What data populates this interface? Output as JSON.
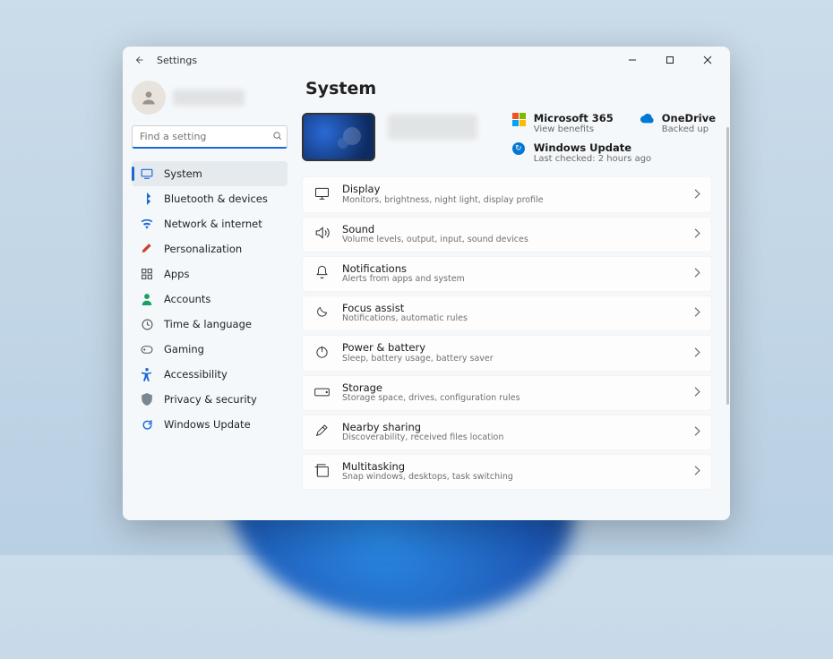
{
  "window": {
    "title": "Settings"
  },
  "page": {
    "title": "System"
  },
  "search": {
    "placeholder": "Find a setting"
  },
  "nav": [
    {
      "id": "system",
      "label": "System",
      "icon_color": "#1d67d6",
      "selected": true
    },
    {
      "id": "bluetooth",
      "label": "Bluetooth & devices",
      "icon_color": "#1d67d6",
      "selected": false
    },
    {
      "id": "network",
      "label": "Network & internet",
      "icon_color": "#1d67d6",
      "selected": false
    },
    {
      "id": "personalization",
      "label": "Personalization",
      "icon_color": "#c8442b",
      "selected": false
    },
    {
      "id": "apps",
      "label": "Apps",
      "icon_color": "#555",
      "selected": false
    },
    {
      "id": "accounts",
      "label": "Accounts",
      "icon_color": "#1aa061",
      "selected": false
    },
    {
      "id": "time",
      "label": "Time & language",
      "icon_color": "#555",
      "selected": false
    },
    {
      "id": "gaming",
      "label": "Gaming",
      "icon_color": "#555",
      "selected": false
    },
    {
      "id": "accessibility",
      "label": "Accessibility",
      "icon_color": "#1d67d6",
      "selected": false
    },
    {
      "id": "privacy",
      "label": "Privacy & security",
      "icon_color": "#7a8690",
      "selected": false
    },
    {
      "id": "update",
      "label": "Windows Update",
      "icon_color": "#1d67d6",
      "selected": false
    }
  ],
  "status": {
    "ms365": {
      "title": "Microsoft 365",
      "sub": "View benefits"
    },
    "onedrive": {
      "title": "OneDrive",
      "sub": "Backed up"
    },
    "winupdate": {
      "title": "Windows Update",
      "sub": "Last checked: 2 hours ago"
    }
  },
  "cards": [
    {
      "id": "display",
      "title": "Display",
      "sub": "Monitors, brightness, night light, display profile"
    },
    {
      "id": "sound",
      "title": "Sound",
      "sub": "Volume levels, output, input, sound devices"
    },
    {
      "id": "notifications",
      "title": "Notifications",
      "sub": "Alerts from apps and system"
    },
    {
      "id": "focus",
      "title": "Focus assist",
      "sub": "Notifications, automatic rules"
    },
    {
      "id": "power",
      "title": "Power & battery",
      "sub": "Sleep, battery usage, battery saver"
    },
    {
      "id": "storage",
      "title": "Storage",
      "sub": "Storage space, drives, configuration rules"
    },
    {
      "id": "nearby",
      "title": "Nearby sharing",
      "sub": "Discoverability, received files location"
    },
    {
      "id": "multitasking",
      "title": "Multitasking",
      "sub": "Snap windows, desktops, task switching"
    }
  ]
}
